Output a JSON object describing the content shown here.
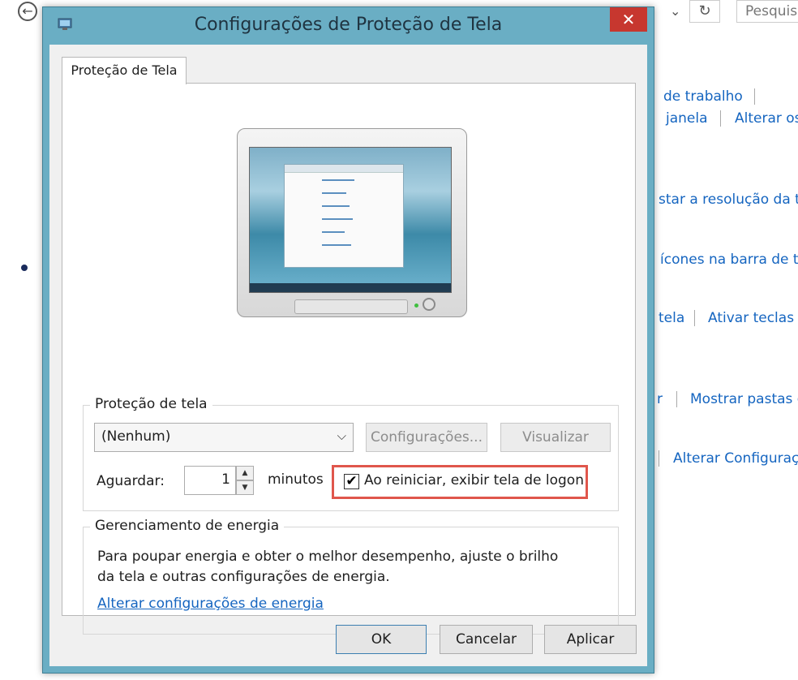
{
  "background": {
    "search_placeholder": "Pesquis",
    "links": [
      "de trabalho",
      "janela",
      "Alterar os",
      "star a resolução da tel",
      "ícones na barra de ta",
      "tela",
      "Ativar teclas d",
      "r",
      "Mostrar pastas e",
      "Alterar Configuraç"
    ]
  },
  "dialog": {
    "title": "Configurações de Proteção de Tela",
    "close_glyph": "✕",
    "tab_label": "Proteção de Tela",
    "screensaver_group": {
      "legend": "Proteção de tela",
      "selected_option": "(Nenhum)",
      "settings_button": "Configurações...",
      "preview_button": "Visualizar",
      "wait_label": "Aguardar:",
      "wait_value": "1",
      "minutes_label": "minutos",
      "logon_checkbox_label": "Ao reiniciar, exibir tela de logon",
      "logon_checked": true
    },
    "power_group": {
      "legend": "Gerenciamento de energia",
      "description_line1": "Para poupar energia e obter o melhor desempenho, ajuste o brilho",
      "description_line2": "da tela e outras configurações de energia.",
      "link": "Alterar configurações de energia"
    },
    "buttons": {
      "ok": "OK",
      "cancel": "Cancelar",
      "apply": "Aplicar"
    }
  }
}
